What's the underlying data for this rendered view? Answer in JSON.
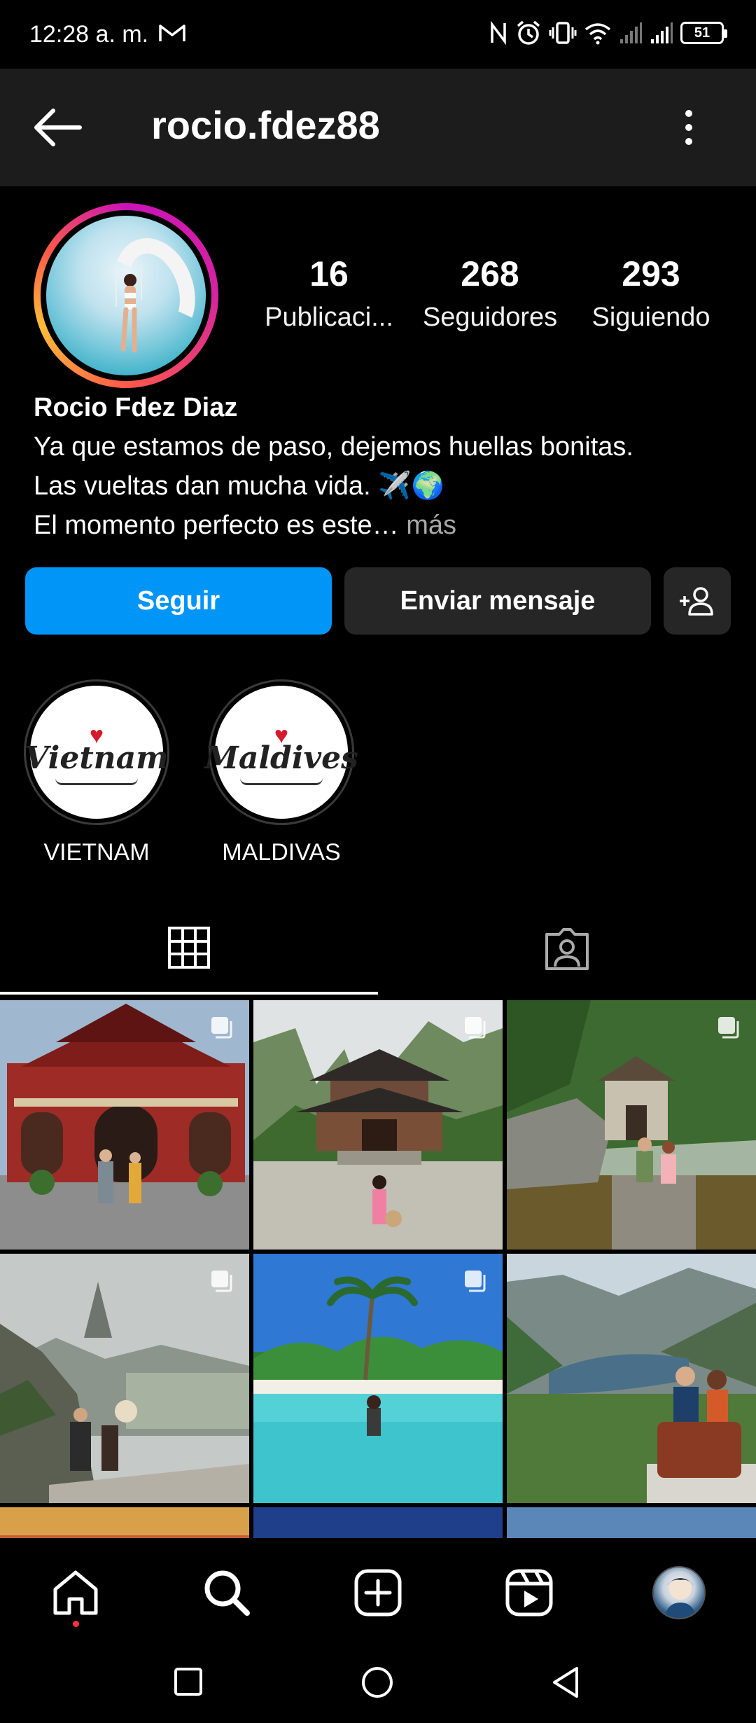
{
  "status_bar": {
    "time": "12:28 a. m.",
    "battery": "51"
  },
  "header": {
    "username": "rocio.fdez88"
  },
  "profile": {
    "stats": [
      {
        "value": "16",
        "label": "Publicaci..."
      },
      {
        "value": "268",
        "label": "Seguidores"
      },
      {
        "value": "293",
        "label": "Siguiendo"
      }
    ],
    "name": "Rocio Fdez Diaz",
    "bio_line_1": "Ya que estamos de paso, dejemos huellas bonitas.",
    "bio_line_2": "Las vueltas dan mucha vida. ✈️🌍",
    "bio_line_3": "El momento perfecto es este…",
    "bio_more": " más"
  },
  "actions": {
    "follow_label": "Seguir",
    "message_label": "Enviar mensaje"
  },
  "highlights": [
    {
      "label": "VIETNAM",
      "script_text": "Vietnam"
    },
    {
      "label": "MALDIVAS",
      "script_text": "Maldives"
    }
  ],
  "colors": {
    "accent_blue": "#0095f6",
    "button_gray": "#262626",
    "header_bg": "#1c1c1c",
    "notification_dot": "#ff3040"
  },
  "grid_posts": [
    {
      "scene": "temple-red-gate",
      "multi": true
    },
    {
      "scene": "pagoda-mountains",
      "multi": true
    },
    {
      "scene": "stone-gate-river",
      "multi": true
    },
    {
      "scene": "misty-cliff-rice-fields",
      "multi": true
    },
    {
      "scene": "tropical-beach-palm",
      "multi": true
    },
    {
      "scene": "fjord-couple",
      "multi": false
    }
  ],
  "nav_icons": [
    "home-icon",
    "search-icon",
    "create-icon",
    "reels-icon",
    "profile-avatar"
  ],
  "system_nav_icons": [
    "recents-square-icon",
    "home-circle-icon",
    "back-triangle-icon"
  ]
}
